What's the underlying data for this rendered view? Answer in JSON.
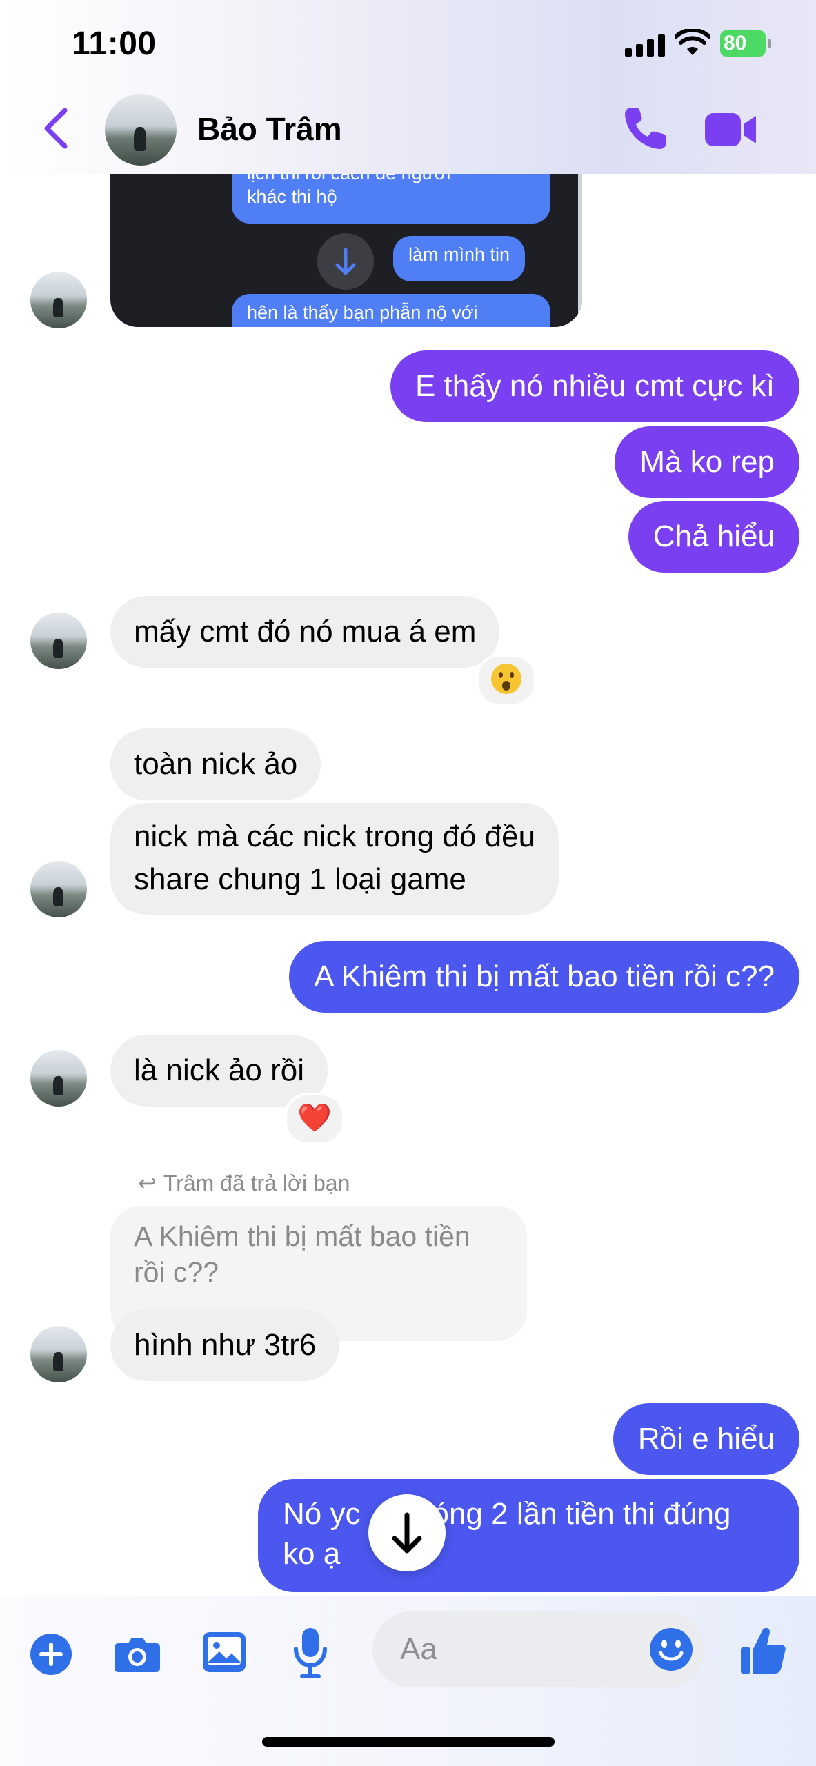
{
  "status_bar": {
    "time": "11:00",
    "battery": "80"
  },
  "header": {
    "contact_name": "Bảo Trâm"
  },
  "attachment": {
    "lines": [
      "lịch thi rồi cách để người",
      "khác thi hộ",
      "làm mình tin",
      "hên là thấy bạn phẫn nộ với"
    ]
  },
  "messages": [
    {
      "text": "E thấy nó nhiều cmt cực kì"
    },
    {
      "text": "Mà ko rep"
    },
    {
      "text": "Chả hiểu"
    },
    {
      "text": "mấy cmt đó nó mua á em"
    },
    {
      "text": "toàn nick ảo"
    },
    {
      "line1": "nick mà các nick trong đó đều",
      "line2": "share chung 1 loại game"
    },
    {
      "text": "A Khiêm thi bị mất bao tiền rồi c??"
    },
    {
      "text": "là nick ảo rồi"
    },
    {
      "text": "hình như 3tr6"
    },
    {
      "text": "Rồi e hiểu"
    },
    {
      "line1": "Nó yc",
      "line1_end": "óng 2 lần tiền thi đúng",
      "line2": "ko ạ"
    }
  ],
  "reply": {
    "note": "Trâm đã trả lời bạn",
    "quoted_line1": "A Khiêm thi bị mất bao tiền",
    "quoted_line2": "rồi c??"
  },
  "reactions": {
    "heart": "❤️"
  },
  "composer": {
    "placeholder": "Aa"
  },
  "colors": {
    "accent": "#7b3ff2",
    "blue_bubble": "#4b57ef",
    "icon_blue": "#2f6fe8"
  }
}
